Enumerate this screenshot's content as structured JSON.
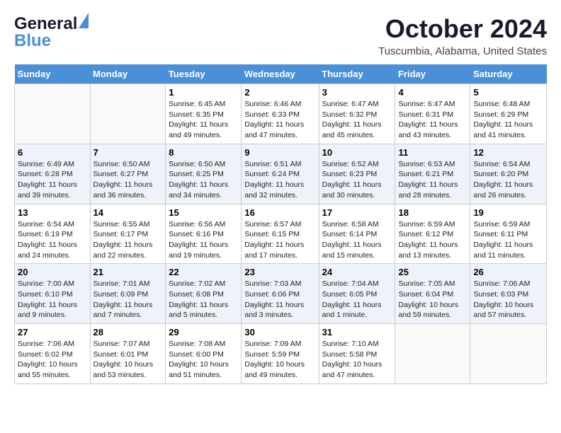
{
  "header": {
    "logo_line1": "General",
    "logo_line2": "Blue",
    "month": "October 2024",
    "location": "Tuscumbia, Alabama, United States"
  },
  "days_of_week": [
    "Sunday",
    "Monday",
    "Tuesday",
    "Wednesday",
    "Thursday",
    "Friday",
    "Saturday"
  ],
  "weeks": [
    [
      {
        "day": "",
        "info": ""
      },
      {
        "day": "",
        "info": ""
      },
      {
        "day": "1",
        "info": "Sunrise: 6:45 AM\nSunset: 6:35 PM\nDaylight: 11 hours and 49 minutes."
      },
      {
        "day": "2",
        "info": "Sunrise: 6:46 AM\nSunset: 6:33 PM\nDaylight: 11 hours and 47 minutes."
      },
      {
        "day": "3",
        "info": "Sunrise: 6:47 AM\nSunset: 6:32 PM\nDaylight: 11 hours and 45 minutes."
      },
      {
        "day": "4",
        "info": "Sunrise: 6:47 AM\nSunset: 6:31 PM\nDaylight: 11 hours and 43 minutes."
      },
      {
        "day": "5",
        "info": "Sunrise: 6:48 AM\nSunset: 6:29 PM\nDaylight: 11 hours and 41 minutes."
      }
    ],
    [
      {
        "day": "6",
        "info": "Sunrise: 6:49 AM\nSunset: 6:28 PM\nDaylight: 11 hours and 39 minutes."
      },
      {
        "day": "7",
        "info": "Sunrise: 6:50 AM\nSunset: 6:27 PM\nDaylight: 11 hours and 36 minutes."
      },
      {
        "day": "8",
        "info": "Sunrise: 6:50 AM\nSunset: 6:25 PM\nDaylight: 11 hours and 34 minutes."
      },
      {
        "day": "9",
        "info": "Sunrise: 6:51 AM\nSunset: 6:24 PM\nDaylight: 11 hours and 32 minutes."
      },
      {
        "day": "10",
        "info": "Sunrise: 6:52 AM\nSunset: 6:23 PM\nDaylight: 11 hours and 30 minutes."
      },
      {
        "day": "11",
        "info": "Sunrise: 6:53 AM\nSunset: 6:21 PM\nDaylight: 11 hours and 28 minutes."
      },
      {
        "day": "12",
        "info": "Sunrise: 6:54 AM\nSunset: 6:20 PM\nDaylight: 11 hours and 26 minutes."
      }
    ],
    [
      {
        "day": "13",
        "info": "Sunrise: 6:54 AM\nSunset: 6:19 PM\nDaylight: 11 hours and 24 minutes."
      },
      {
        "day": "14",
        "info": "Sunrise: 6:55 AM\nSunset: 6:17 PM\nDaylight: 11 hours and 22 minutes."
      },
      {
        "day": "15",
        "info": "Sunrise: 6:56 AM\nSunset: 6:16 PM\nDaylight: 11 hours and 19 minutes."
      },
      {
        "day": "16",
        "info": "Sunrise: 6:57 AM\nSunset: 6:15 PM\nDaylight: 11 hours and 17 minutes."
      },
      {
        "day": "17",
        "info": "Sunrise: 6:58 AM\nSunset: 6:14 PM\nDaylight: 11 hours and 15 minutes."
      },
      {
        "day": "18",
        "info": "Sunrise: 6:59 AM\nSunset: 6:12 PM\nDaylight: 11 hours and 13 minutes."
      },
      {
        "day": "19",
        "info": "Sunrise: 6:59 AM\nSunset: 6:11 PM\nDaylight: 11 hours and 11 minutes."
      }
    ],
    [
      {
        "day": "20",
        "info": "Sunrise: 7:00 AM\nSunset: 6:10 PM\nDaylight: 11 hours and 9 minutes."
      },
      {
        "day": "21",
        "info": "Sunrise: 7:01 AM\nSunset: 6:09 PM\nDaylight: 11 hours and 7 minutes."
      },
      {
        "day": "22",
        "info": "Sunrise: 7:02 AM\nSunset: 6:08 PM\nDaylight: 11 hours and 5 minutes."
      },
      {
        "day": "23",
        "info": "Sunrise: 7:03 AM\nSunset: 6:06 PM\nDaylight: 11 hours and 3 minutes."
      },
      {
        "day": "24",
        "info": "Sunrise: 7:04 AM\nSunset: 6:05 PM\nDaylight: 11 hours and 1 minute."
      },
      {
        "day": "25",
        "info": "Sunrise: 7:05 AM\nSunset: 6:04 PM\nDaylight: 10 hours and 59 minutes."
      },
      {
        "day": "26",
        "info": "Sunrise: 7:06 AM\nSunset: 6:03 PM\nDaylight: 10 hours and 57 minutes."
      }
    ],
    [
      {
        "day": "27",
        "info": "Sunrise: 7:06 AM\nSunset: 6:02 PM\nDaylight: 10 hours and 55 minutes."
      },
      {
        "day": "28",
        "info": "Sunrise: 7:07 AM\nSunset: 6:01 PM\nDaylight: 10 hours and 53 minutes."
      },
      {
        "day": "29",
        "info": "Sunrise: 7:08 AM\nSunset: 6:00 PM\nDaylight: 10 hours and 51 minutes."
      },
      {
        "day": "30",
        "info": "Sunrise: 7:09 AM\nSunset: 5:59 PM\nDaylight: 10 hours and 49 minutes."
      },
      {
        "day": "31",
        "info": "Sunrise: 7:10 AM\nSunset: 5:58 PM\nDaylight: 10 hours and 47 minutes."
      },
      {
        "day": "",
        "info": ""
      },
      {
        "day": "",
        "info": ""
      }
    ]
  ]
}
